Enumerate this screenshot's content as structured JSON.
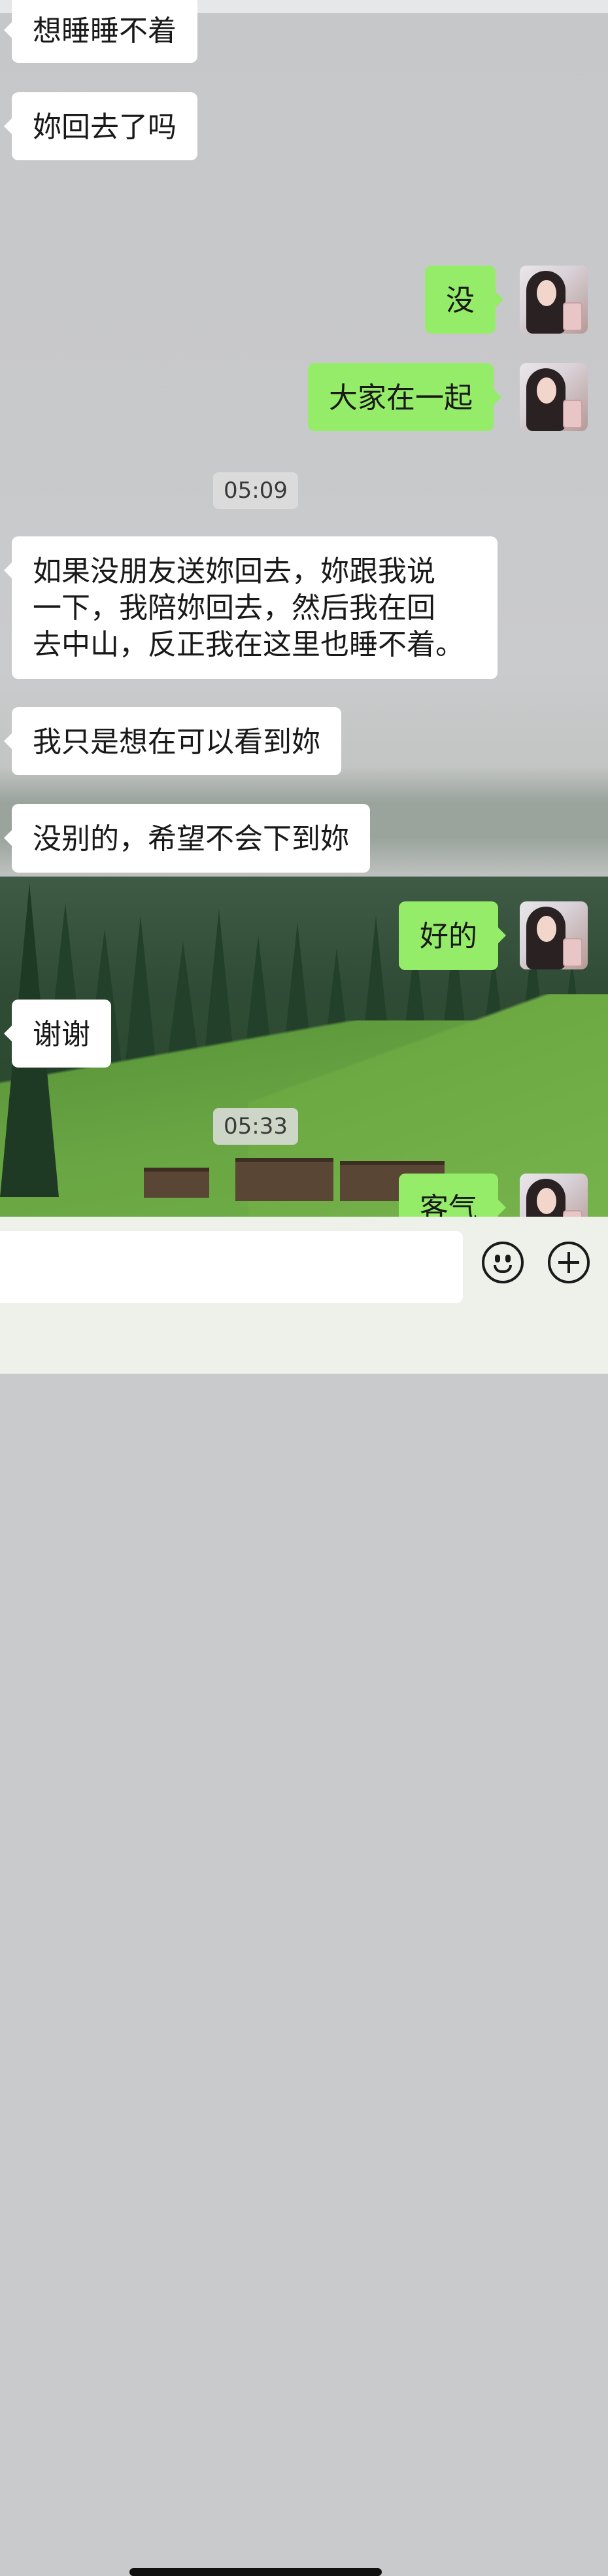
{
  "messages": [
    {
      "side": "in",
      "text": "想睡睡不着"
    },
    {
      "side": "in",
      "text": "妳回去了吗"
    },
    {
      "side": "out",
      "text": "没"
    },
    {
      "side": "out",
      "text": "大家在一起"
    },
    {
      "side": "time",
      "text": "05:09"
    },
    {
      "side": "in",
      "text": "如果没朋友送妳回去，妳跟我说\n一下，我陪妳回去，然后我在回\n去中山，反正我在这里也睡不着。"
    },
    {
      "side": "in",
      "text": "我只是想在可以看到妳"
    },
    {
      "side": "in",
      "text": "没别的，希望不会下到妳"
    },
    {
      "side": "out",
      "text": "好的"
    },
    {
      "side": "in",
      "text": "谢谢"
    },
    {
      "side": "time",
      "text": "05:33"
    },
    {
      "side": "out",
      "text": "客气"
    }
  ],
  "input": {
    "value": ""
  },
  "icons": {
    "emoji": "emoji-icon",
    "plus": "plus-icon"
  }
}
